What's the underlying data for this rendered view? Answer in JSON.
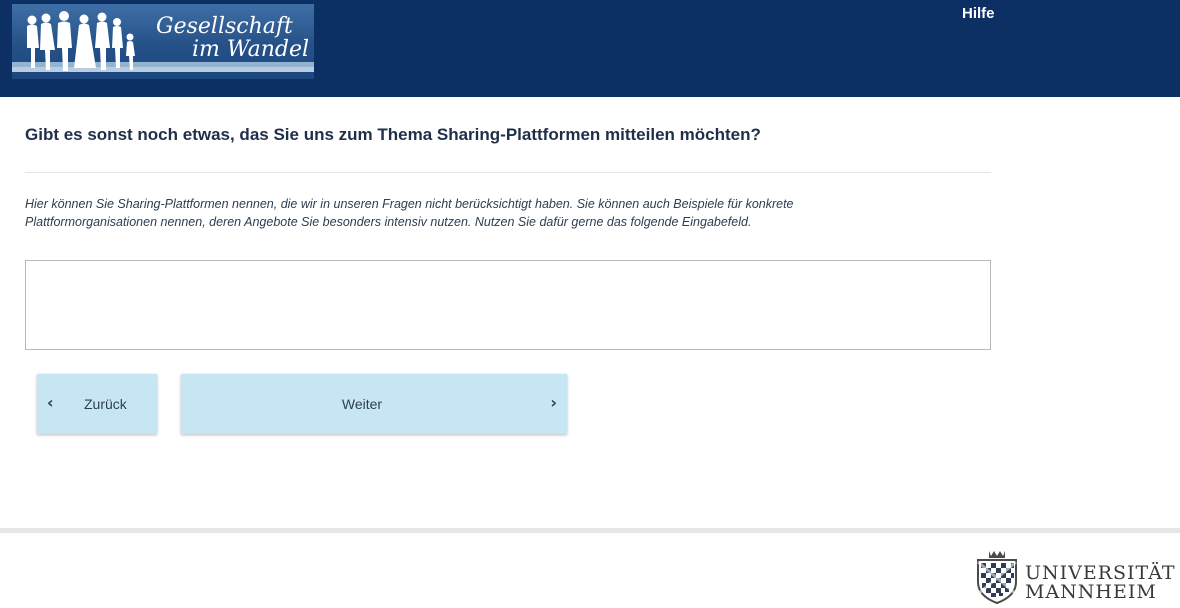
{
  "header": {
    "logo": {
      "line1": "Gesellschaft",
      "line2": "im Wandel"
    },
    "help_label": "Hilfe"
  },
  "question": {
    "title": "Gibt es sonst noch etwas, das Sie uns zum Thema Sharing-Plattformen mitteilen möchten?",
    "hint": "Hier können Sie Sharing-Plattformen nennen, die wir in unseren Fragen nicht berücksichtigt haben. Sie können auch Beispiele für konkrete Plattformorganisationen nennen, deren Angebote Sie besonders intensiv nutzen. Nutzen Sie dafür gerne das folgende Eingabefeld.",
    "answer_value": ""
  },
  "navigation": {
    "back_label": "Zurück",
    "next_label": "Weiter",
    "back_icon": "chevron-left-icon",
    "next_icon": "chevron-right-icon"
  },
  "footer": {
    "university_line1": "UNIVERSITÄT",
    "university_line2": "MANNHEIM"
  },
  "colors": {
    "header_bg": "#0c2f64",
    "button_bg": "#c7e6f3",
    "question_text": "#1f2f4a"
  }
}
